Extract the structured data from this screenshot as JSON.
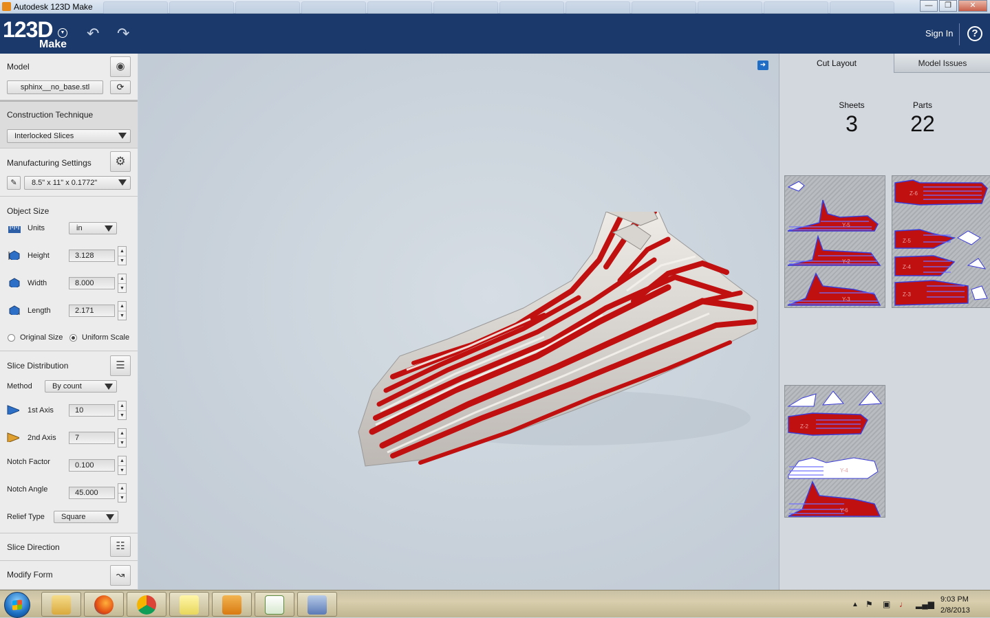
{
  "window": {
    "title": "Autodesk 123D Make"
  },
  "header": {
    "logo_main": "123D",
    "logo_sub": "Make",
    "sign_in": "Sign In",
    "help": "?"
  },
  "left_panel": {
    "model": {
      "title": "Model",
      "file": "sphinx__no_base.stl"
    },
    "construction": {
      "title": "Construction Technique",
      "value": "Interlocked Slices"
    },
    "manufacturing": {
      "title": "Manufacturing Settings",
      "value": "8.5\" x 11\" x 0.1772\""
    },
    "object_size": {
      "title": "Object Size",
      "units_label": "Units",
      "units_value": "in",
      "height_label": "Height",
      "height_value": "3.128",
      "width_label": "Width",
      "width_value": "8.000",
      "length_label": "Length",
      "length_value": "2.171",
      "original_size": "Original Size",
      "uniform_scale": "Uniform Scale"
    },
    "slice_distribution": {
      "title": "Slice Distribution",
      "method_label": "Method",
      "method_value": "By count",
      "axis1_label": "1st Axis",
      "axis1_value": "10",
      "axis2_label": "2nd Axis",
      "axis2_value": "7",
      "notch_factor_label": "Notch Factor",
      "notch_factor_value": "0.100",
      "notch_angle_label": "Notch Angle",
      "notch_angle_value": "45.000",
      "relief_label": "Relief Type",
      "relief_value": "Square"
    },
    "slice_direction": {
      "title": "Slice Direction"
    },
    "modify_form": {
      "title": "Modify Form"
    }
  },
  "right_panel": {
    "tabs": [
      "Cut Layout",
      "Model Issues"
    ],
    "sheets_label": "Sheets",
    "sheets_value": "3",
    "parts_label": "Parts",
    "parts_value": "22",
    "sheet1_labels": [
      "Y-5",
      "Y-2",
      "Y-3"
    ],
    "sheet2_labels": [
      "Z-6",
      "Z-5",
      "Z-4",
      "Z-3"
    ],
    "sheet3_labels": [
      "Z-2",
      "Y-4",
      "Y-6"
    ]
  },
  "taskbar": {
    "time": "9:03 PM",
    "date": "2/8/2013"
  },
  "colors": {
    "header_bg": "#1b3a6b",
    "slice_red": "#c01010",
    "slice_light": "#e9e6e2",
    "layout_blue": "#3b3cd6"
  }
}
